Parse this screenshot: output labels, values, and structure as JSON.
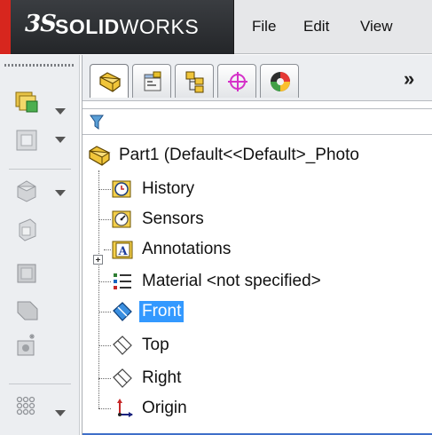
{
  "app": {
    "logo_mark": "3S",
    "logo_bold": "SOLID",
    "logo_light": "WORKS"
  },
  "menu": [
    "File",
    "Edit",
    "View"
  ],
  "panel": {
    "tabs": [
      {
        "name": "feature-manager",
        "icon": "part-icon",
        "active": true
      },
      {
        "name": "property-manager",
        "icon": "property-manager-icon",
        "active": false
      },
      {
        "name": "configuration-manager",
        "icon": "configuration-manager-icon",
        "active": false
      },
      {
        "name": "dimxpert-manager",
        "icon": "dimxpert-icon",
        "active": false
      },
      {
        "name": "display-manager",
        "icon": "display-manager-icon",
        "active": false
      }
    ],
    "more_label": "»"
  },
  "tree": {
    "root_label": "Part1  (Default<<Default>_Photo",
    "items": [
      {
        "label": "History",
        "icon": "history-icon",
        "selected": false
      },
      {
        "label": "Sensors",
        "icon": "sensors-icon",
        "selected": false
      },
      {
        "label": "Annotations",
        "icon": "annotations-icon",
        "selected": false,
        "expandable": true
      },
      {
        "label": "Material <not specified>",
        "icon": "material-icon",
        "selected": false
      },
      {
        "label": "Front",
        "icon": "plane-icon",
        "selected": true
      },
      {
        "label": "Top",
        "icon": "plane-icon",
        "selected": false
      },
      {
        "label": "Right",
        "icon": "plane-icon",
        "selected": false
      },
      {
        "label": "Origin",
        "icon": "origin-icon",
        "selected": false
      }
    ]
  },
  "colors": {
    "selection": "#3399ff",
    "brand_red": "#d7261e",
    "logo_bg": "#2c2e31"
  }
}
